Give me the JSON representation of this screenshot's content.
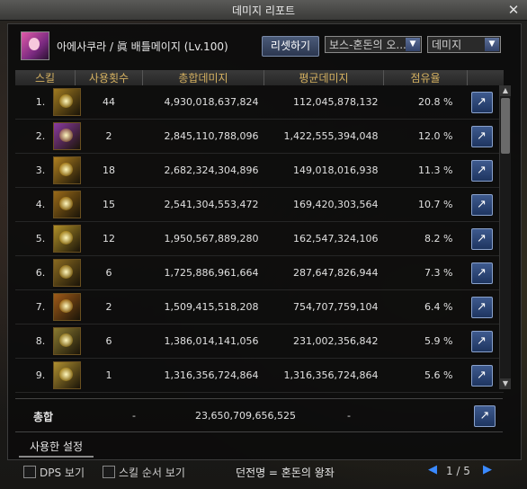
{
  "window": {
    "title": "데미지 리포트"
  },
  "header": {
    "char_name": "아에사쿠라 / 眞 배틀메이지 (Lv.100)",
    "reset_label": "리셋하기",
    "boss_select": "보스-혼돈의 오...",
    "metric_select": "데미지"
  },
  "columns": {
    "skill": "스킬",
    "count": "사용횟수",
    "total": "총합데미지",
    "avg": "평균데미지",
    "share": "점유율"
  },
  "rows": [
    {
      "idx": "1.",
      "count": "44",
      "total": "4,930,018,637,824",
      "avg": "112,045,878,132",
      "share": "20.8 %",
      "color": "#a07a20"
    },
    {
      "idx": "2.",
      "count": "2",
      "total": "2,845,110,788,096",
      "avg": "1,422,555,394,048",
      "share": "12.0 %",
      "color": "#8a3aa0"
    },
    {
      "idx": "3.",
      "count": "18",
      "total": "2,682,324,304,896",
      "avg": "149,018,016,938",
      "share": "11.3 %",
      "color": "#b08020"
    },
    {
      "idx": "4.",
      "count": "15",
      "total": "2,541,304,553,472",
      "avg": "169,420,303,564",
      "share": "10.7 %",
      "color": "#9a6a18"
    },
    {
      "idx": "5.",
      "count": "12",
      "total": "1,950,567,889,280",
      "avg": "162,547,324,106",
      "share": "8.2 %",
      "color": "#b09028"
    },
    {
      "idx": "6.",
      "count": "6",
      "total": "1,725,886,961,664",
      "avg": "287,647,826,944",
      "share": "7.3 %",
      "color": "#8a6a20"
    },
    {
      "idx": "7.",
      "count": "2",
      "total": "1,509,415,518,208",
      "avg": "754,707,759,104",
      "share": "6.4 %",
      "color": "#a05a18"
    },
    {
      "idx": "8.",
      "count": "6",
      "total": "1,386,014,141,056",
      "avg": "231,002,356,842",
      "share": "5.9 %",
      "color": "#8a7a30"
    },
    {
      "idx": "9.",
      "count": "1",
      "total": "1,316,356,724,864",
      "avg": "1,316,356,724,864",
      "share": "5.6 %",
      "color": "#b09030"
    }
  ],
  "total": {
    "label": "총합",
    "count": "-",
    "value": "23,650,709,656,525",
    "avg": "-"
  },
  "settings_tab": "사용한 설정",
  "footer": {
    "dps_label": "DPS 보기",
    "order_label": "스킬 순서 보기",
    "dungeon": "던전명 = 혼돈의 왕좌",
    "page": "1 / 5"
  }
}
